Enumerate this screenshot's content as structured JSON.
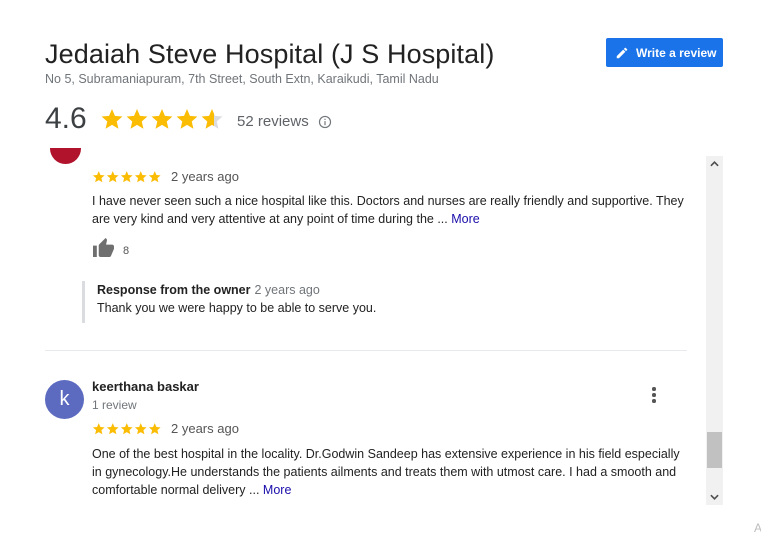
{
  "place": {
    "title": "Jedaiah Steve Hospital (J S Hospital)",
    "address": "No 5, Subramaniapuram, 7th Street, South Extn, Karaikudi, Tamil Nadu",
    "rating": "4.6",
    "rating_value": 4.6,
    "reviews_count": "52 reviews"
  },
  "actions": {
    "write_review": "Write a review"
  },
  "icons": {
    "pencil": "pencil-icon",
    "info": "info-icon",
    "thumb": "thumbs-up-icon",
    "menu": "more-vert-icon"
  },
  "colors": {
    "accent": "#1a73e8",
    "star": "#fbbc04",
    "star_empty": "#dadce0",
    "link": "#1a0dab",
    "avatar": "#5c6bc0"
  },
  "reviews": [
    {
      "stars": 5,
      "time": "2 years ago",
      "text": "I have never seen such a nice hospital like this. Doctors and nurses are really friendly and supportive. They are very kind and very attentive at any point of time during the ...",
      "more": "More",
      "likes": "8",
      "owner_response": {
        "label": "Response from the owner",
        "time": "2 years ago",
        "text": "Thank you we were happy to be able to serve you."
      }
    },
    {
      "avatar_letter": "k",
      "name": "keerthana baskar",
      "review_count": "1 review",
      "stars": 5,
      "time": "2 years ago",
      "text": "One of the best hospital in the locality. Dr.Godwin Sandeep has extensive experience in his field especially in gynecology.He understands the patients ailments and treats them with utmost care. I had a smooth and comfortable normal delivery ...",
      "more": "More"
    }
  ],
  "corner_text": "A"
}
